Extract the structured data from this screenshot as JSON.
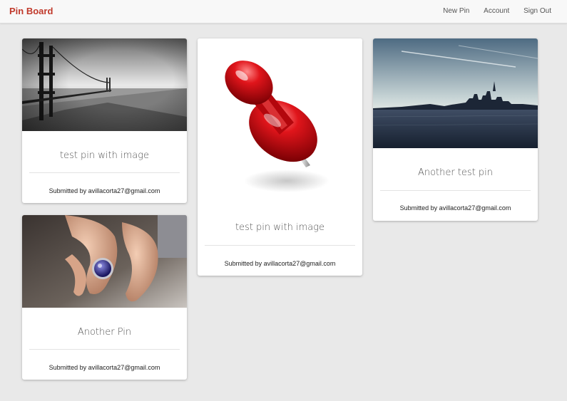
{
  "navbar": {
    "brand": "Pin Board",
    "links": [
      "New Pin",
      "Account",
      "Sign Out"
    ]
  },
  "pins": [
    {
      "title": "test pin with image",
      "submitted": "Submitted by avillacorta27@gmail.com"
    },
    {
      "title": "test pin with image",
      "submitted": "Submitted by avillacorta27@gmail.com"
    },
    {
      "title": "Another test pin",
      "submitted": "Submitted by avillacorta27@gmail.com"
    },
    {
      "title": "Another Pin",
      "submitted": "Submitted by avillacorta27@gmail.com"
    }
  ],
  "colors": {
    "brand": "#c0392b",
    "background": "#e9e9e9",
    "navbar": "#f8f8f8"
  }
}
